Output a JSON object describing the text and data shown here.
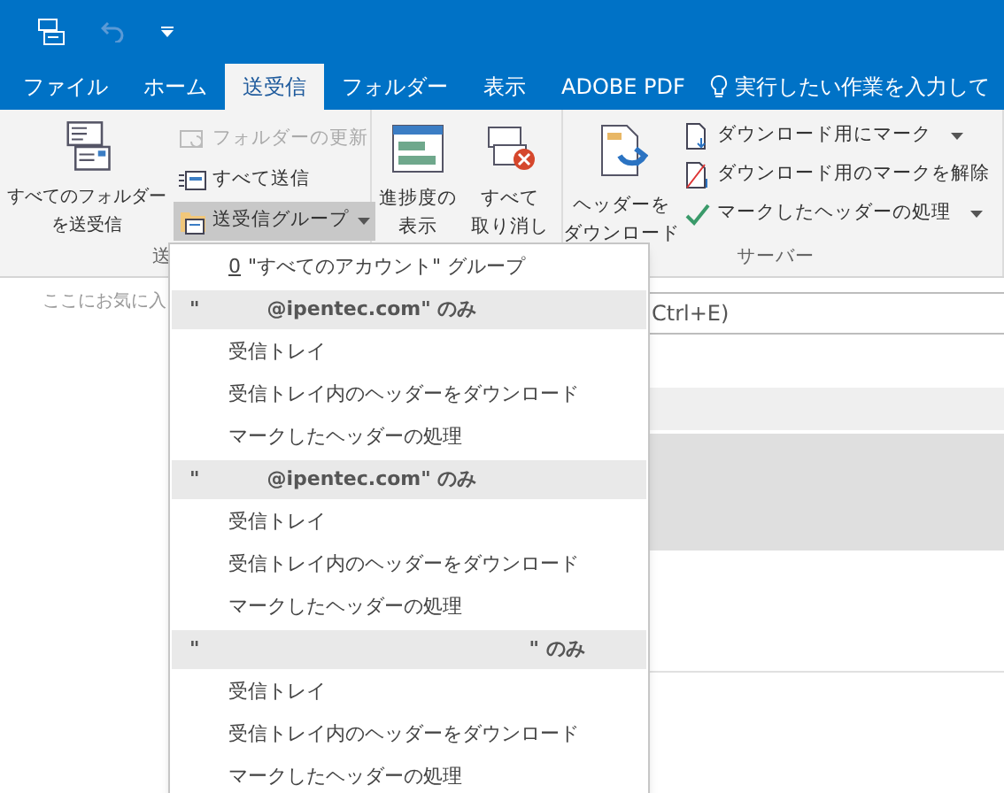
{
  "quick_access": {
    "undo_disabled": true
  },
  "tabs": [
    {
      "label": "ファイル",
      "selected": false
    },
    {
      "label": "ホーム",
      "selected": false
    },
    {
      "label": "送受信",
      "selected": true
    },
    {
      "label": "フォルダー",
      "selected": false
    },
    {
      "label": "表示",
      "selected": false
    },
    {
      "label": "ADOBE PDF",
      "selected": false
    }
  ],
  "tell_me": "実行したい作業を入力して",
  "ribbon": {
    "send_receive_all": "すべてのフォルダーを送受信",
    "small_buttons": [
      {
        "label": "フォルダーの更新",
        "disabled": true,
        "pressed": false
      },
      {
        "label": "すべて送信",
        "disabled": false,
        "pressed": false
      },
      {
        "label": "送受信グループ",
        "disabled": false,
        "pressed": true
      }
    ],
    "group_label_1": "送",
    "progress": "進捗度の表示",
    "cancel_all": "すべて取り消し",
    "download_headers": "ヘッダーをダウンロード",
    "server_buttons": [
      {
        "label": "ダウンロード用にマーク"
      },
      {
        "label": "ダウンロード用のマークを解除"
      },
      {
        "label": "マークしたヘッダーの処理"
      }
    ],
    "group_label_3": "サーバー"
  },
  "favorites": "ここにお気に入",
  "search": {
    "placeholder": "Ctrl+E)"
  },
  "menu": [
    {
      "kind": "item",
      "accel": "0",
      "label": "\"すべてのアカウント\" グループ"
    },
    {
      "kind": "header",
      "prefix": "\"",
      "label": "@ipentec.com\" のみ"
    },
    {
      "kind": "item",
      "label": "受信トレイ"
    },
    {
      "kind": "item",
      "label": "受信トレイ内のヘッダーをダウンロード"
    },
    {
      "kind": "item",
      "label": "マークしたヘッダーの処理"
    },
    {
      "kind": "header",
      "prefix": "\"",
      "label": "@ipentec.com\" のみ"
    },
    {
      "kind": "item",
      "label": "受信トレイ"
    },
    {
      "kind": "item",
      "label": "受信トレイ内のヘッダーをダウンロード"
    },
    {
      "kind": "item",
      "label": "マークしたヘッダーの処理"
    },
    {
      "kind": "header",
      "prefix": "\"",
      "label": "\" のみ"
    },
    {
      "kind": "item",
      "label": "受信トレイ"
    },
    {
      "kind": "item",
      "label": "受信トレイ内のヘッダーをダウンロード"
    },
    {
      "kind": "item",
      "label": "マークしたヘッダーの処理"
    }
  ]
}
